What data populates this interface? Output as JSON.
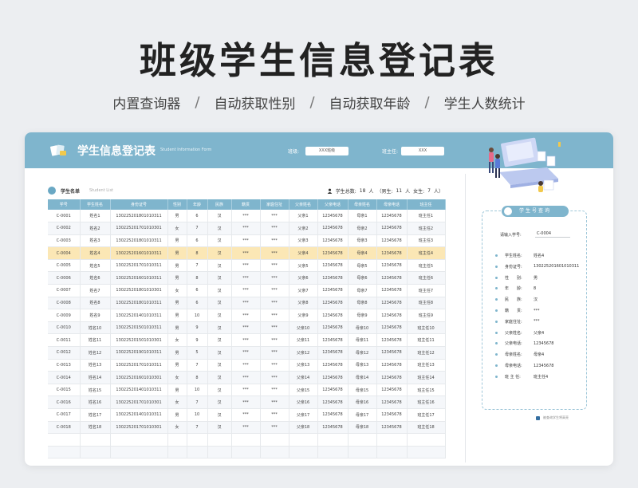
{
  "hero": {
    "title": "班级学生信息登记表",
    "features": [
      "内置查询器",
      "自动获取性别",
      "自动获取年龄",
      "学生人数统计"
    ],
    "separator": "/"
  },
  "banner": {
    "title": "学生信息登记表",
    "subtitle": "Student Information Form",
    "class_label": "班级:",
    "class_value": "XXX班级",
    "teacher_label": "班主任:",
    "teacher_value": "XXX"
  },
  "list": {
    "title": "学生名单",
    "title_en": "Student List",
    "total_label": "学生总数:",
    "total_value": "18",
    "unit": "人",
    "male_label": "（男生:",
    "male_value": "11",
    "female_label": "女生:",
    "female_value": "7",
    "close": "人）",
    "columns": [
      "学号",
      "学生姓名",
      "身份证号",
      "性别",
      "年龄",
      "民族",
      "籍贯",
      "家庭住址",
      "父亲姓名",
      "父亲电话",
      "母亲姓名",
      "母亲电话",
      "班主任"
    ],
    "rows": [
      [
        "C-0001",
        "姓名1",
        "130225201801010311",
        "男",
        "6",
        "汉",
        "***",
        "***",
        "父亲1",
        "12345678",
        "母亲1",
        "12345678",
        "班主任1"
      ],
      [
        "C-0002",
        "姓名2",
        "130225201701010301",
        "女",
        "7",
        "汉",
        "***",
        "***",
        "父亲2",
        "12345678",
        "母亲2",
        "12345678",
        "班主任2"
      ],
      [
        "C-0003",
        "姓名3",
        "130225201801010311",
        "男",
        "6",
        "汉",
        "***",
        "***",
        "父亲3",
        "12345678",
        "母亲3",
        "12345678",
        "班主任3"
      ],
      [
        "C-0004",
        "姓名4",
        "130225201601010311",
        "男",
        "8",
        "汉",
        "***",
        "***",
        "父亲4",
        "12345678",
        "母亲4",
        "12345678",
        "班主任4"
      ],
      [
        "C-0005",
        "姓名5",
        "130225201701010311",
        "男",
        "7",
        "汉",
        "***",
        "***",
        "父亲5",
        "12345678",
        "母亲5",
        "12345678",
        "班主任5"
      ],
      [
        "C-0006",
        "姓名6",
        "130225201601010311",
        "男",
        "8",
        "汉",
        "***",
        "***",
        "父亲6",
        "12345678",
        "母亲6",
        "12345678",
        "班主任6"
      ],
      [
        "C-0007",
        "姓名7",
        "130225201801010301",
        "女",
        "6",
        "汉",
        "***",
        "***",
        "父亲7",
        "12345678",
        "母亲7",
        "12345678",
        "班主任7"
      ],
      [
        "C-0008",
        "姓名8",
        "130225201801010311",
        "男",
        "6",
        "汉",
        "***",
        "***",
        "父亲8",
        "12345678",
        "母亲8",
        "12345678",
        "班主任8"
      ],
      [
        "C-0009",
        "姓名9",
        "130225201401010311",
        "男",
        "10",
        "汉",
        "***",
        "***",
        "父亲9",
        "12345678",
        "母亲9",
        "12345678",
        "班主任9"
      ],
      [
        "C-0010",
        "姓名10",
        "130225201501010311",
        "男",
        "9",
        "汉",
        "***",
        "***",
        "父亲10",
        "12345678",
        "母亲10",
        "12345678",
        "班主任10"
      ],
      [
        "C-0011",
        "姓名11",
        "130225201501010301",
        "女",
        "9",
        "汉",
        "***",
        "***",
        "父亲11",
        "12345678",
        "母亲11",
        "12345678",
        "班主任11"
      ],
      [
        "C-0012",
        "姓名12",
        "130225201901010311",
        "男",
        "5",
        "汉",
        "***",
        "***",
        "父亲12",
        "12345678",
        "母亲12",
        "12345678",
        "班主任12"
      ],
      [
        "C-0013",
        "姓名13",
        "130225201701010311",
        "男",
        "7",
        "汉",
        "***",
        "***",
        "父亲13",
        "12345678",
        "母亲13",
        "12345678",
        "班主任13"
      ],
      [
        "C-0014",
        "姓名14",
        "130225201601010301",
        "女",
        "8",
        "汉",
        "***",
        "***",
        "父亲14",
        "12345678",
        "母亲14",
        "12345678",
        "班主任14"
      ],
      [
        "C-0015",
        "姓名15",
        "130225201401010311",
        "男",
        "10",
        "汉",
        "***",
        "***",
        "父亲15",
        "12345678",
        "母亲15",
        "12345678",
        "班主任15"
      ],
      [
        "C-0016",
        "姓名16",
        "130225201701010301",
        "女",
        "7",
        "汉",
        "***",
        "***",
        "父亲16",
        "12345678",
        "母亲16",
        "12345678",
        "班主任16"
      ],
      [
        "C-0017",
        "姓名17",
        "130225201401010311",
        "男",
        "10",
        "汉",
        "***",
        "***",
        "父亲17",
        "12345678",
        "母亲17",
        "12345678",
        "班主任17"
      ],
      [
        "C-0018",
        "姓名18",
        "130225201701010301",
        "女",
        "7",
        "汉",
        "***",
        "***",
        "父亲18",
        "12345678",
        "母亲18",
        "12345678",
        "班主任18"
      ],
      [
        "",
        "",
        "",
        "",
        "",
        "",
        "",
        "",
        "",
        "",
        "",
        "",
        ""
      ],
      [
        "",
        "",
        "",
        "",
        "",
        "",
        "",
        "",
        "",
        "",
        "",
        "",
        ""
      ]
    ],
    "highlight_row": 3
  },
  "query": {
    "title": "学生号查询",
    "input_label": "请输入学号:",
    "input_value": "C-0004",
    "details": [
      {
        "k": "学生姓名:",
        "v": "姓名4"
      },
      {
        "k": "身份证号:",
        "v": "130225201601010311"
      },
      {
        "k": "性　　别:",
        "v": "男"
      },
      {
        "k": "年　　龄:",
        "v": "8"
      },
      {
        "k": "民　　族:",
        "v": "汉"
      },
      {
        "k": "籍　　贯:",
        "v": "***"
      },
      {
        "k": "家庭住址:",
        "v": "***"
      },
      {
        "k": "父亲姓名:",
        "v": "父亲4"
      },
      {
        "k": "父亲电话:",
        "v": "12345678"
      },
      {
        "k": "母亲姓名:",
        "v": "母亲4"
      },
      {
        "k": "母亲电话:",
        "v": "12345678"
      },
      {
        "k": "班 主 任:",
        "v": "班主任4"
      }
    ],
    "footnote": "被查询学生将高亮"
  },
  "colors": {
    "accent": "#7fb5cd",
    "highlight": "#fbe7b5"
  }
}
